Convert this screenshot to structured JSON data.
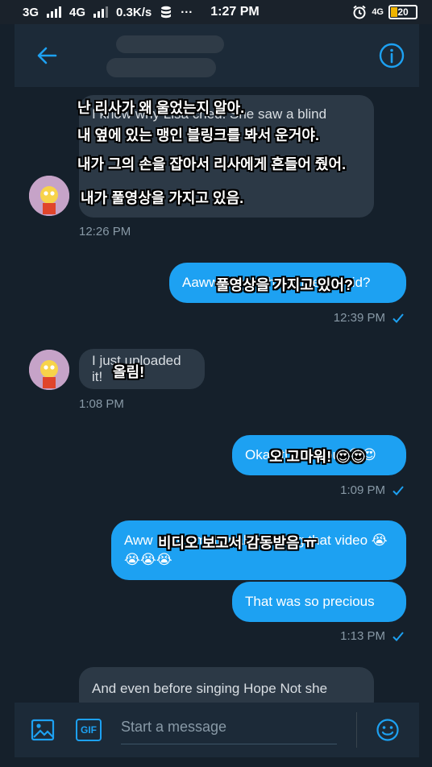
{
  "status_bar": {
    "net1": "3G",
    "net2": "4G",
    "speed": "0.3K/s",
    "dots": "···",
    "time": "1:27 PM",
    "net3": "4G",
    "battery": "20"
  },
  "header": {
    "back_icon": "arrow-left-icon",
    "info_icon": "info-icon"
  },
  "messages": [
    {
      "side": "left",
      "text": "I know why Lisa cried. She saw a blind",
      "time": "12:26 PM"
    },
    {
      "side": "right",
      "text": "Aaww do you have the full vid?",
      "time": "12:39 PM"
    },
    {
      "side": "left",
      "text": "I just uploaded it!",
      "time": "1:08 PM"
    },
    {
      "side": "right",
      "text": "Okay thank you! 😍😍",
      "time": "1:09 PM"
    },
    {
      "side": "right",
      "text_line1": "Aww I got emotional watching that video 😭",
      "text_line2": "😭😭😭"
    },
    {
      "side": "right",
      "text": "That was so  precious",
      "time": "1:13 PM"
    },
    {
      "side": "left",
      "text": "And even before singing Hope Not she"
    }
  ],
  "captions": {
    "c1": "난 리사가 왜 울었는지 알아.",
    "c2": "내 옆에 있는 맹인 블링크를 봐서 운거야.",
    "c3": "내가 그의 손을 잡아서 리사에게 흔들어 줬어.",
    "c4": "내가 풀영상을 가지고 있음.",
    "c5": "풀영상을 가지고 있어?",
    "c6": "올림!",
    "c7": "오 고마워! 😍😍",
    "c8": "비디오 보고서 감동받음 ㅠ"
  },
  "composer": {
    "placeholder": "Start a message",
    "gif_label": "GIF"
  },
  "colors": {
    "background": "#15202b",
    "accent": "#1da1f2",
    "bubble_received": "#2c3946",
    "muted": "#8899a6"
  }
}
